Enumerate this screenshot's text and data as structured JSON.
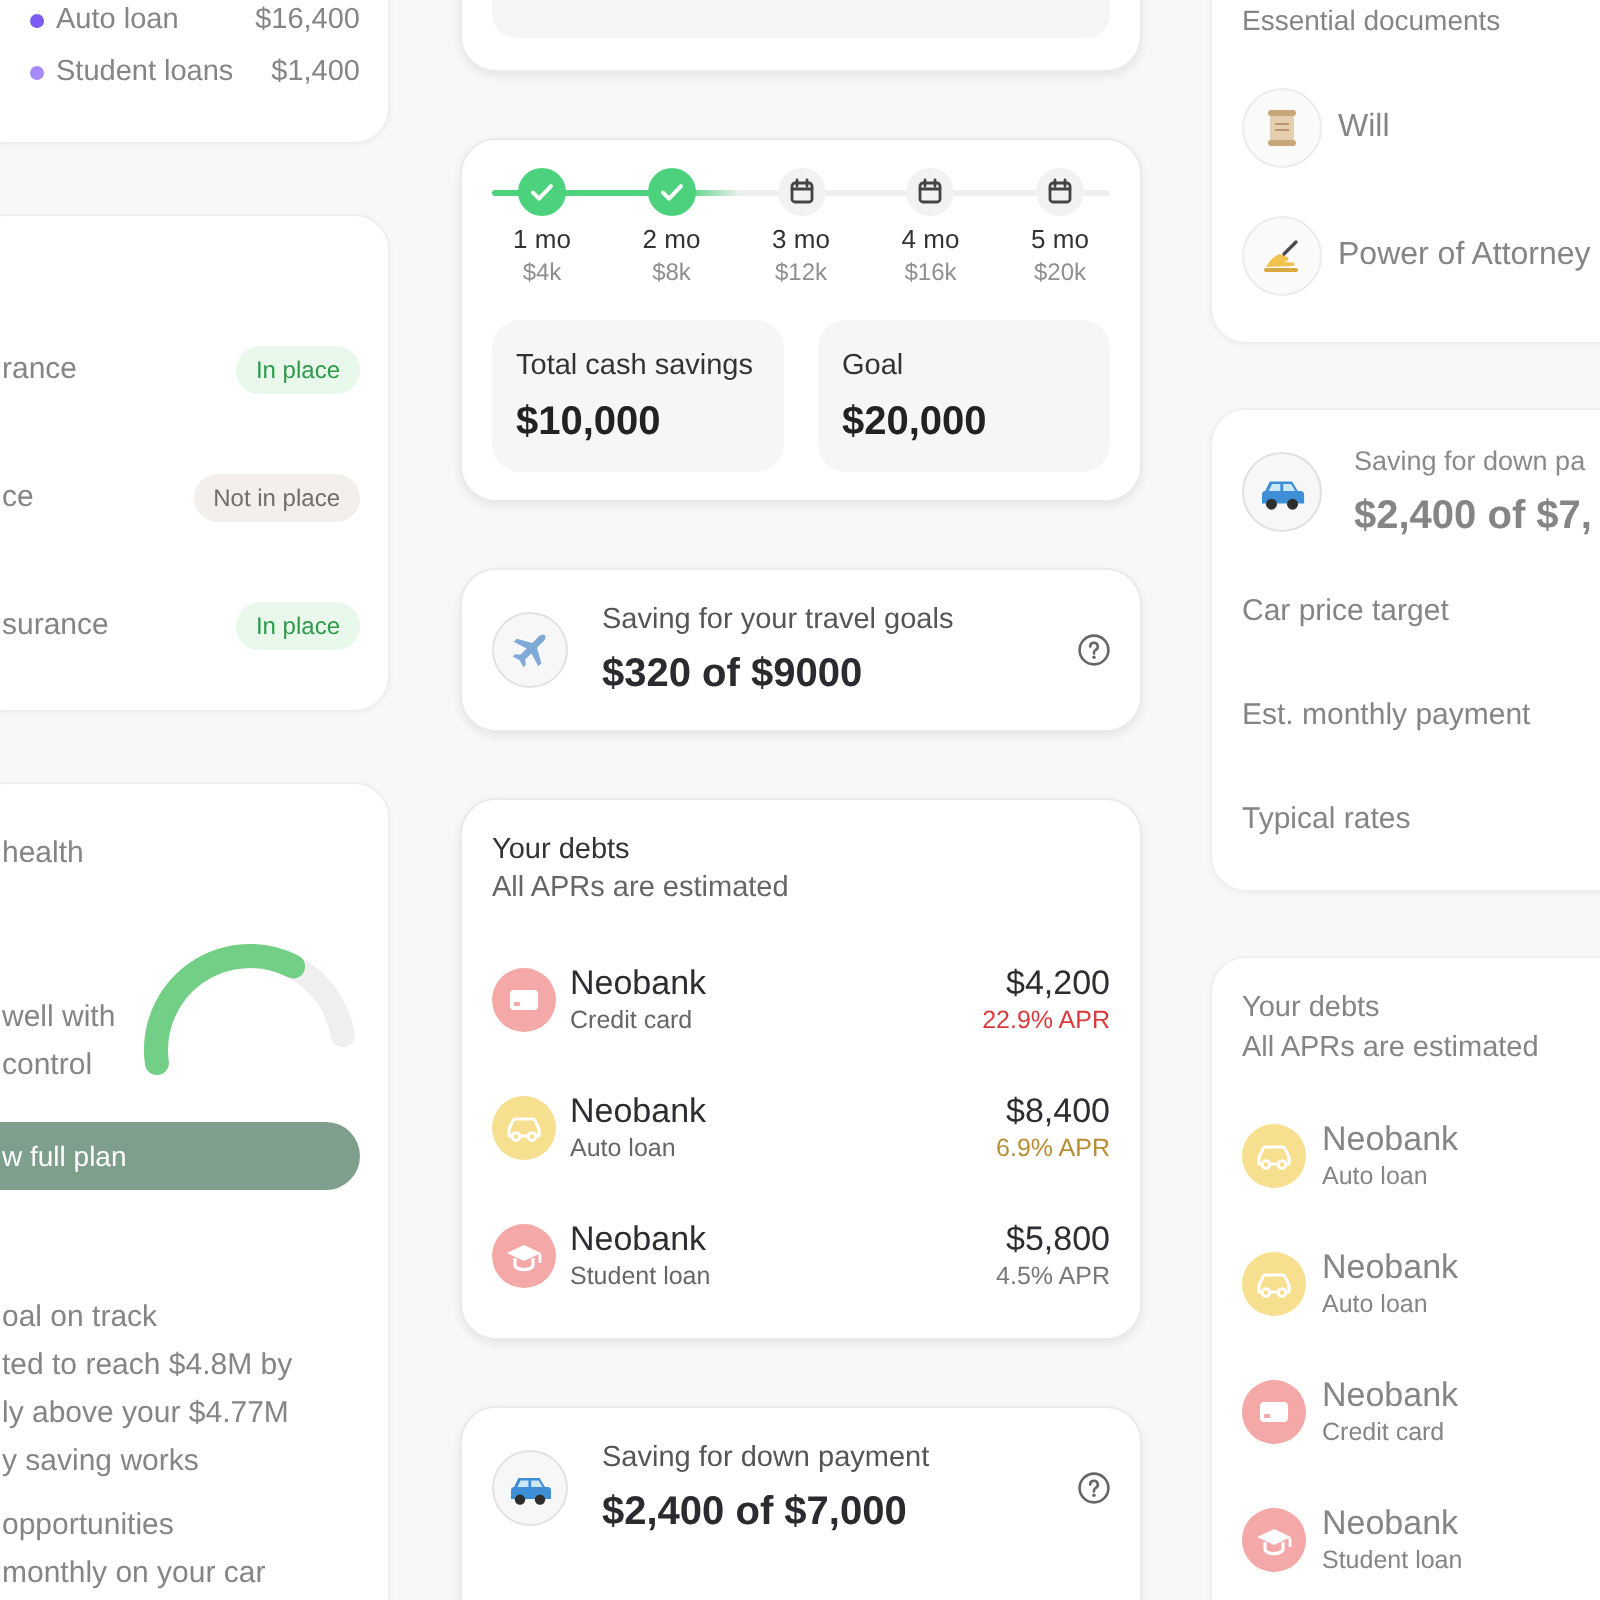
{
  "left_column": {
    "loans_card": {
      "rows": [
        {
          "label": "Auto loan",
          "amount": "$16,400",
          "color": "#7c5cf2"
        },
        {
          "label": "Student loans",
          "amount": "$1,400",
          "color": "#a78bfa"
        }
      ]
    },
    "coverage_card": {
      "rows": [
        {
          "label": "rance",
          "status": "In place",
          "in_place": true
        },
        {
          "label": "ce",
          "status": "Not in place",
          "in_place": false
        },
        {
          "label": "surance",
          "status": "In place",
          "in_place": true
        }
      ]
    },
    "health_card": {
      "title": "health",
      "summary_lines": [
        "well with",
        "control"
      ],
      "gauge": {
        "level": 0.7
      },
      "button": "w full plan",
      "sections": [
        {
          "lines": [
            "oal on track",
            "ted to reach $4.8M by",
            "ly above your $4.77M",
            "y saving works"
          ]
        },
        {
          "lines": [
            "opportunities",
            "monthly on your car"
          ]
        }
      ]
    }
  },
  "center_column": {
    "progress_card": {
      "steps": [
        {
          "label": "1 mo",
          "amount": "$4k",
          "done": true
        },
        {
          "label": "2 mo",
          "amount": "$8k",
          "done": true
        },
        {
          "label": "3 mo",
          "amount": "$12k",
          "done": false
        },
        {
          "label": "4 mo",
          "amount": "$16k",
          "done": false
        },
        {
          "label": "5 mo",
          "amount": "$20k",
          "done": false
        }
      ],
      "stats": [
        {
          "label": "Total cash savings",
          "value": "$10,000"
        },
        {
          "label": "Goal",
          "value": "$20,000"
        }
      ]
    },
    "travel_goal": {
      "kind": "travel",
      "title": "Saving for your travel goals",
      "amount": "$320 of $9000"
    },
    "debts_card": {
      "title": "Your debts",
      "subtitle": "All APRs are estimated",
      "debts": [
        {
          "kind": "credit_card",
          "name": "Neobank",
          "type": "Credit card",
          "amount": "$4,200",
          "apr": "22.9% APR",
          "color": "#d83b3b"
        },
        {
          "kind": "auto_loan",
          "name": "Neobank",
          "type": "Auto loan",
          "amount": "$8,400",
          "apr": "6.9% APR",
          "color": "#b88d33"
        },
        {
          "kind": "student_loan",
          "name": "Neobank",
          "type": "Student loan",
          "amount": "$5,800",
          "apr": "4.5% APR",
          "color": "#777777"
        }
      ]
    },
    "down_payment_goal": {
      "kind": "car",
      "title": "Saving for down payment",
      "amount": "$2,400 of $7,000"
    }
  },
  "right_column": {
    "documents_card": {
      "title": "Essential documents",
      "documents": [
        {
          "kind": "will",
          "label": "Will"
        },
        {
          "kind": "power_of_attorney",
          "label": "Power of Attorney"
        }
      ]
    },
    "down_payment_card": {
      "kind": "car",
      "title": "Saving for down pa",
      "amount": "$2,400 of $7,",
      "rows": [
        "Car price target",
        "Est. monthly payment",
        "Typical rates"
      ]
    },
    "debts_card": {
      "title": "Your debts",
      "subtitle": "All APRs are estimated",
      "debts": [
        {
          "kind": "auto_loan",
          "name": "Neobank",
          "type": "Auto loan"
        },
        {
          "kind": "auto_loan",
          "name": "Neobank",
          "type": "Auto loan"
        },
        {
          "kind": "credit_card",
          "name": "Neobank",
          "type": "Credit card"
        },
        {
          "kind": "student_loan",
          "name": "Neobank",
          "type": "Student loan"
        }
      ]
    }
  }
}
